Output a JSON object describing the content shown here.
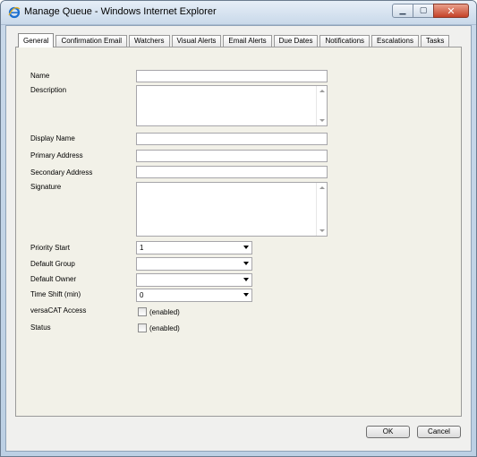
{
  "window": {
    "title": "Manage Queue - Windows Internet Explorer",
    "buttons": {
      "minimize": "▁",
      "maximize": "▢",
      "close": "✕"
    }
  },
  "tabs": [
    {
      "label": "General",
      "active": true
    },
    {
      "label": "Confirmation Email",
      "active": false
    },
    {
      "label": "Watchers",
      "active": false
    },
    {
      "label": "Visual Alerts",
      "active": false
    },
    {
      "label": "Email Alerts",
      "active": false
    },
    {
      "label": "Due Dates",
      "active": false
    },
    {
      "label": "Notifications",
      "active": false
    },
    {
      "label": "Escalations",
      "active": false
    },
    {
      "label": "Tasks",
      "active": false
    }
  ],
  "form": {
    "name_label": "Name",
    "name_value": "",
    "description_label": "Description",
    "description_value": "",
    "display_name_label": "Display Name",
    "display_name_value": "",
    "primary_address_label": "Primary Address",
    "primary_address_value": "",
    "secondary_address_label": "Secondary Address",
    "secondary_address_value": "",
    "signature_label": "Signature",
    "signature_value": "",
    "priority_start_label": "Priority Start",
    "priority_start_value": "1",
    "default_group_label": "Default Group",
    "default_group_value": "",
    "default_owner_label": "Default Owner",
    "default_owner_value": "",
    "time_shift_label": "Time Shift (min)",
    "time_shift_value": "0",
    "versacat_label": "versaCAT Access",
    "versacat_checkbox_label": "(enabled)",
    "versacat_checked": false,
    "status_label": "Status",
    "status_checkbox_label": "(enabled)",
    "status_checked": false
  },
  "footer": {
    "ok_label": "OK",
    "cancel_label": "Cancel"
  }
}
